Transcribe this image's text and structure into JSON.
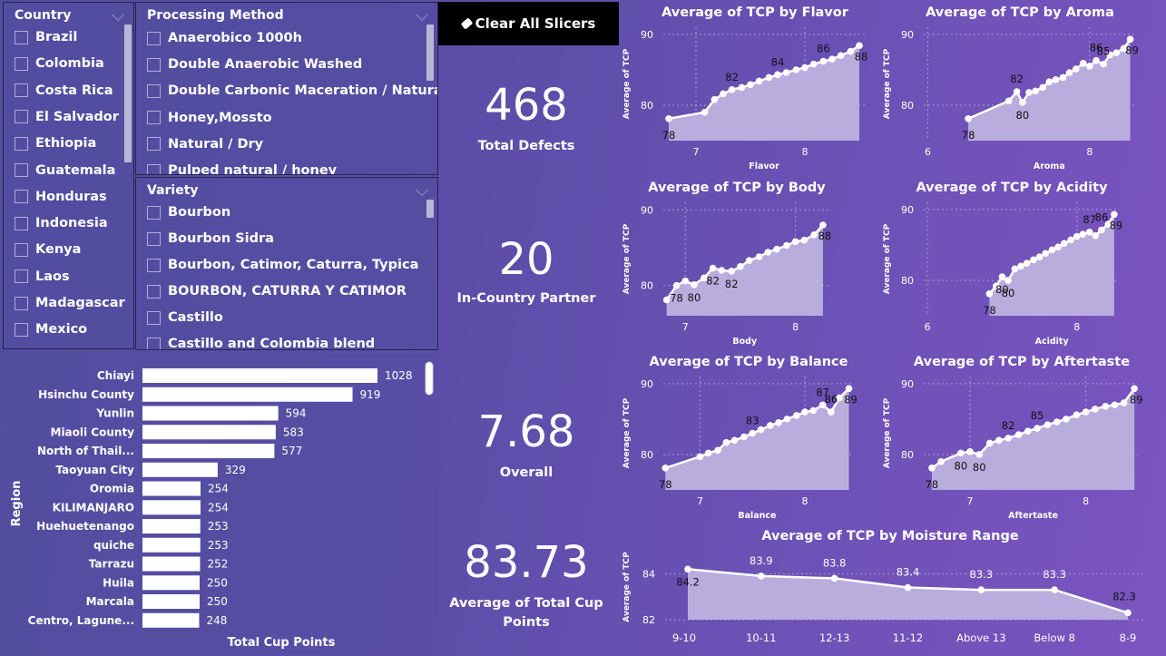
{
  "colors": {
    "background_start": "#514e9e",
    "background_end": "#7b54c0",
    "area_fill": "#bdb2df",
    "line": "#ffffff",
    "button_bg": "#000000"
  },
  "country_slicer": {
    "title": "Country",
    "items": [
      "Brazil",
      "Colombia",
      "Costa Rica",
      "El Salvador",
      "Ethiopia",
      "Guatemala",
      "Honduras",
      "Indonesia",
      "Kenya",
      "Laos",
      "Madagascar",
      "Mexico"
    ]
  },
  "processing_slicer": {
    "title": "Processing Method",
    "items": [
      "Anaerobico 1000h",
      "Double Anaerobic Washed",
      "Double Carbonic Maceration / Natural",
      "Honey,Mossto",
      "Natural / Dry",
      "Pulped natural / honey"
    ]
  },
  "variety_slicer": {
    "title": "Variety",
    "items": [
      "Bourbon",
      "Bourbon Sidra",
      "Bourbon, Catimor, Caturra, Typica",
      "BOURBON, CATURRA Y CATIMOR",
      "Castillo",
      "Castillo and Colombia blend"
    ]
  },
  "clear_button": {
    "label": "Clear All Slicers",
    "icon": "eraser-icon"
  },
  "kpis": [
    {
      "value": "468",
      "label": "Total Defects"
    },
    {
      "value": "20",
      "label": "In-Country Partner"
    },
    {
      "value": "7.68",
      "label": "Overall"
    },
    {
      "value": "83.73",
      "label": "Average of Total Cup Points"
    }
  ],
  "chart_data": [
    {
      "id": "region",
      "type": "bar",
      "orientation": "horizontal",
      "ylabel": "Region",
      "xlabel": "Total Cup Points",
      "categories": [
        "Chiayi",
        "Hsinchu County",
        "Yunlin",
        "Miaoli County",
        "North of Thail...",
        "Taoyuan City",
        "Oromia",
        "KILIMANJARO",
        "Huehuetenango",
        "quiche",
        "Tarrazu",
        "Huila",
        "Marcala",
        "Centro, Lagune..."
      ],
      "values": [
        1028,
        919,
        594,
        583,
        577,
        329,
        254,
        254,
        253,
        253,
        252,
        250,
        250,
        248
      ]
    },
    {
      "id": "flavor",
      "type": "area",
      "title": "Average of TCP by Flavor",
      "xlabel": "Flavor",
      "ylabel": "Average of TCP",
      "xlim": [
        6.7,
        8.55
      ],
      "ylim": [
        75,
        91
      ],
      "x_ticks": [
        {
          "value": 7,
          "label": "7"
        },
        {
          "value": 8,
          "label": "8"
        }
      ],
      "y_ticks": [
        {
          "value": 80,
          "label": "80"
        },
        {
          "value": 90,
          "label": "90"
        }
      ],
      "x": [
        6.75,
        7.08,
        7.17,
        7.25,
        7.33,
        7.42,
        7.5,
        7.58,
        7.67,
        7.75,
        7.83,
        7.92,
        8.0,
        8.08,
        8.17,
        8.25,
        8.33,
        8.42,
        8.5
      ],
      "y": [
        78.1,
        79.0,
        80.8,
        81.6,
        82.2,
        82.5,
        82.9,
        83.4,
        83.9,
        84.3,
        84.6,
        85.0,
        85.3,
        85.8,
        86.2,
        86.5,
        87.0,
        87.6,
        88.4
      ],
      "labels": [
        {
          "index": 0,
          "text": "78"
        },
        {
          "index": 4,
          "text": "82"
        },
        {
          "index": 9,
          "text": "84"
        },
        {
          "index": 14,
          "text": "86"
        },
        {
          "index": 18,
          "text": "88"
        }
      ]
    },
    {
      "id": "aroma",
      "type": "area",
      "title": "Average of TCP by Aroma",
      "xlabel": "Aroma",
      "ylabel": "Average of TCP",
      "xlim": [
        5.95,
        8.55
      ],
      "ylim": [
        75,
        91
      ],
      "x_ticks": [
        {
          "value": 6,
          "label": "6"
        },
        {
          "value": 8,
          "label": "8"
        }
      ],
      "y_ticks": [
        {
          "value": 80,
          "label": "80"
        },
        {
          "value": 90,
          "label": "90"
        }
      ],
      "x": [
        6.5,
        7.0,
        7.1,
        7.17,
        7.25,
        7.33,
        7.42,
        7.5,
        7.58,
        7.67,
        7.75,
        7.83,
        7.92,
        8.0,
        8.08,
        8.17,
        8.25,
        8.33,
        8.42,
        8.5
      ],
      "y": [
        78.1,
        80.6,
        81.9,
        80.4,
        81.8,
        82.0,
        82.5,
        83.3,
        83.6,
        83.9,
        84.6,
        85.1,
        85.9,
        85.5,
        86.3,
        85.8,
        87.1,
        87.4,
        88.0,
        89.3
      ],
      "labels": [
        {
          "index": 0,
          "text": "78"
        },
        {
          "index": 3,
          "text": "80"
        },
        {
          "index": 2,
          "text": "82"
        },
        {
          "index": 14,
          "text": "86"
        },
        {
          "index": 15,
          "text": "85"
        },
        {
          "index": 19,
          "text": "89"
        }
      ]
    },
    {
      "id": "body",
      "type": "area",
      "title": "Average of TCP by Body",
      "xlabel": "Body",
      "ylabel": "Average of TCP",
      "xlim": [
        6.8,
        8.3
      ],
      "ylim": [
        76,
        91
      ],
      "x_ticks": [
        {
          "value": 7,
          "label": "7"
        },
        {
          "value": 8,
          "label": "8"
        }
      ],
      "y_ticks": [
        {
          "value": 80,
          "label": "80"
        },
        {
          "value": 90,
          "label": "90"
        }
      ],
      "x": [
        6.83,
        6.92,
        7.0,
        7.08,
        7.17,
        7.25,
        7.33,
        7.42,
        7.5,
        7.58,
        7.67,
        7.75,
        7.83,
        7.92,
        8.0,
        8.08,
        8.17,
        8.25
      ],
      "y": [
        78.1,
        80.0,
        80.6,
        80.1,
        81.0,
        82.3,
        82.0,
        81.9,
        82.5,
        83.3,
        83.8,
        84.4,
        84.8,
        85.3,
        85.8,
        86.0,
        86.7,
        88.0
      ],
      "labels": [
        {
          "index": 1,
          "text": "78"
        },
        {
          "index": 3,
          "text": "80"
        },
        {
          "index": 5,
          "text": "82"
        },
        {
          "index": 7,
          "text": "82"
        },
        {
          "index": 17,
          "text": "88"
        }
      ]
    },
    {
      "id": "acidity",
      "type": "area",
      "title": "Average of TCP by Acidity",
      "xlabel": "Acidity",
      "ylabel": "Average of TCP",
      "xlim": [
        5.95,
        8.55
      ],
      "ylim": [
        75,
        91
      ],
      "x_ticks": [
        {
          "value": 6,
          "label": "6"
        },
        {
          "value": 8,
          "label": "8"
        }
      ],
      "y_ticks": [
        {
          "value": 80,
          "label": "80"
        },
        {
          "value": 90,
          "label": "90"
        }
      ],
      "x": [
        6.83,
        6.92,
        7.0,
        7.08,
        7.17,
        7.25,
        7.33,
        7.42,
        7.5,
        7.58,
        7.67,
        7.75,
        7.83,
        7.92,
        8.0,
        8.08,
        8.17,
        8.25,
        8.33,
        8.42,
        8.5
      ],
      "y": [
        78.1,
        79.2,
        80.5,
        80.0,
        81.6,
        82.0,
        82.4,
        82.9,
        83.3,
        83.8,
        84.3,
        84.7,
        85.2,
        85.7,
        86.2,
        86.5,
        86.8,
        86.3,
        87.1,
        87.9,
        89.3
      ],
      "labels": [
        {
          "index": 0,
          "text": "78"
        },
        {
          "index": 2,
          "text": "80"
        },
        {
          "index": 3,
          "text": "80"
        },
        {
          "index": 16,
          "text": "87"
        },
        {
          "index": 18,
          "text": "86"
        },
        {
          "index": 20,
          "text": "89"
        }
      ]
    },
    {
      "id": "balance",
      "type": "area",
      "title": "Average of TCP by Balance",
      "xlabel": "Balance",
      "ylabel": "Average of TCP",
      "xlim": [
        6.65,
        8.45
      ],
      "ylim": [
        75,
        91
      ],
      "x_ticks": [
        {
          "value": 7,
          "label": "7"
        },
        {
          "value": 8,
          "label": "8"
        }
      ],
      "y_ticks": [
        {
          "value": 80,
          "label": "80"
        },
        {
          "value": 90,
          "label": "90"
        }
      ],
      "x": [
        6.67,
        7.0,
        7.08,
        7.17,
        7.25,
        7.33,
        7.42,
        7.5,
        7.58,
        7.67,
        7.75,
        7.83,
        7.92,
        8.0,
        8.08,
        8.17,
        8.25,
        8.33,
        8.42
      ],
      "y": [
        78.1,
        79.7,
        80.2,
        80.6,
        81.7,
        82.0,
        82.5,
        83.0,
        83.5,
        84.1,
        84.5,
        85.0,
        85.5,
        86.0,
        86.2,
        87.0,
        86.0,
        88.0,
        89.3
      ],
      "labels": [
        {
          "index": 0,
          "text": "78"
        },
        {
          "index": 7,
          "text": "83"
        },
        {
          "index": 15,
          "text": "87"
        },
        {
          "index": 16,
          "text": "86"
        },
        {
          "index": 18,
          "text": "89"
        }
      ]
    },
    {
      "id": "aftertaste",
      "type": "area",
      "title": "Average of TCP by Aftertaste",
      "xlabel": "Aftertaste",
      "ylabel": "Average of TCP",
      "xlim": [
        6.6,
        8.45
      ],
      "ylim": [
        75,
        91
      ],
      "x_ticks": [
        {
          "value": 7,
          "label": "7"
        },
        {
          "value": 8,
          "label": "8"
        }
      ],
      "y_ticks": [
        {
          "value": 80,
          "label": "80"
        },
        {
          "value": 90,
          "label": "90"
        }
      ],
      "x": [
        6.67,
        6.75,
        6.92,
        7.0,
        7.08,
        7.17,
        7.25,
        7.33,
        7.42,
        7.5,
        7.58,
        7.67,
        7.75,
        7.83,
        7.92,
        8.0,
        8.08,
        8.17,
        8.25,
        8.33,
        8.42
      ],
      "y": [
        78.1,
        79.0,
        80.2,
        80.4,
        80.0,
        81.6,
        82.0,
        82.3,
        82.8,
        83.3,
        83.7,
        84.2,
        84.6,
        85.0,
        85.6,
        86.0,
        86.4,
        86.8,
        87.0,
        87.3,
        89.3
      ],
      "labels": [
        {
          "index": 0,
          "text": "78"
        },
        {
          "index": 2,
          "text": "80"
        },
        {
          "index": 4,
          "text": "80"
        },
        {
          "index": 7,
          "text": "82"
        },
        {
          "index": 10,
          "text": "85"
        },
        {
          "index": 20,
          "text": "89"
        }
      ]
    },
    {
      "id": "moisture",
      "type": "area",
      "title": "Average of TCP by Moisture Range",
      "xlabel": "",
      "ylabel": "Average of TCP",
      "ylim": [
        82,
        85
      ],
      "y_ticks": [
        {
          "value": 82,
          "label": "82"
        },
        {
          "value": 84,
          "label": "84"
        }
      ],
      "categories": [
        "9-10",
        "10-11",
        "12-13",
        "11-12",
        "Above 13",
        "Below 8",
        "8-9"
      ],
      "values": [
        84.2,
        83.9,
        83.8,
        83.4,
        83.3,
        83.3,
        82.3
      ],
      "labels": [
        "84.2",
        "83.9",
        "83.8",
        "83.4",
        "83.3",
        "83.3",
        "82.3"
      ]
    }
  ]
}
